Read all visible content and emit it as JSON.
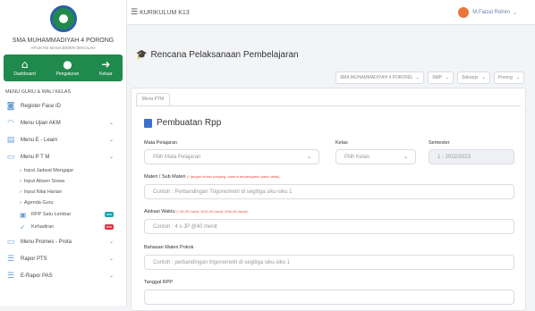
{
  "sidebar": {
    "school_name": "SMA MUHAMMADIYAH 4 PORONG",
    "school_sub": "APLIKASI MANAJEMEN SEKOLAH",
    "quick": [
      {
        "icon": "home-icon",
        "label": "Dashboard"
      },
      {
        "icon": "users-icon",
        "label": "Pengaturan"
      },
      {
        "icon": "logout-icon",
        "label": "Keluar"
      }
    ],
    "menu_heading": "MENU GURU & WALI KELAS",
    "items": [
      {
        "label": "Register Face ID"
      },
      {
        "label": "Menu Ujian AKM"
      },
      {
        "label": "Menu E - Learn"
      },
      {
        "label": "Menu P T M"
      }
    ],
    "subs": [
      "Input Jadwal Mengajar",
      "Input Absen Siswa",
      "Input Nilai Harian",
      "Agenda Guru"
    ],
    "subs2": [
      {
        "label": "RPP Satu Lembar",
        "badge": "new",
        "badge_color": "#17a2b8"
      },
      {
        "label": "Kehadiran",
        "badge": "new",
        "badge_color": "#dc3545"
      }
    ],
    "items2": [
      {
        "label": "Menu Promes - Prota"
      },
      {
        "label": "Rapor PTS"
      },
      {
        "label": "E-Rapor PAS"
      }
    ]
  },
  "topbar": {
    "menu_label": "KURIKULUM K13",
    "user_name": "M.Faizal Rohim"
  },
  "page": {
    "title": "Rencana Pelaksanaan Pembelajaran",
    "filters": [
      {
        "value": "SMA MUHAMMADIYAH 4 PORONG"
      },
      {
        "value": "SMP"
      },
      {
        "value": "Sidoarjo"
      },
      {
        "value": "Porong"
      }
    ]
  },
  "panel": {
    "tab_label": "Menu PTM",
    "card_title": "Pembuatan Rpp",
    "mapel_label": "Mata Pelajaran",
    "mapel_value": "Pilih Mata Pelajaran",
    "kelas_label": "Kelas",
    "kelas_value": "Pilih Kelas",
    "semester_label": "Semester",
    "semester_value": "1 - 2022/2023",
    "materi_label": "Materi / Sub Materi",
    "materi_note": "(* jangan terlalu panjang, karena berpengaruh pada cetak)",
    "materi_placeholder": "Contoh : Perbandingan Trigonometri di segitiga siku-siku 1",
    "alokasi_label": "Alokasi Waktu",
    "alokasi_note": "(* 60-35 menit, 6/19-40 menit, 6/3s-45 menit)",
    "alokasi_placeholder": "Contoh : 4 x JP @40 menit",
    "pokok_label": "Bahasan Materi Pokok",
    "pokok_placeholder": "Contoh : perbandingan trigonometri di segitiga siku-siku 1",
    "tanggal_label": "Tanggal RPP"
  },
  "colors": {
    "brand_green": "#1f8a4c",
    "accent_blue": "#3b6fd1"
  }
}
